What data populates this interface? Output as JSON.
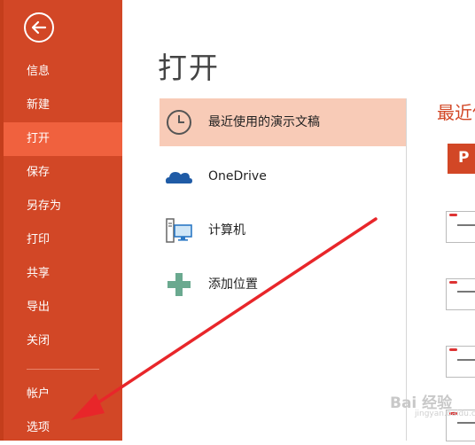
{
  "sidebar": {
    "items": [
      {
        "label": "信息",
        "active": false
      },
      {
        "label": "新建",
        "active": false
      },
      {
        "label": "打开",
        "active": true
      },
      {
        "label": "保存",
        "active": false
      },
      {
        "label": "另存为",
        "active": false
      },
      {
        "label": "打印",
        "active": false
      },
      {
        "label": "共享",
        "active": false
      },
      {
        "label": "导出",
        "active": false
      },
      {
        "label": "关闭",
        "active": false
      }
    ],
    "bottom_items": [
      {
        "label": "帐户"
      },
      {
        "label": "选项"
      }
    ]
  },
  "page": {
    "title": "打开"
  },
  "places": [
    {
      "label": "最近使用的演示文稿",
      "icon": "clock-icon",
      "selected": true
    },
    {
      "label": "OneDrive",
      "icon": "cloud-icon",
      "selected": false
    },
    {
      "label": "计算机",
      "icon": "computer-icon",
      "selected": false
    },
    {
      "label": "添加位置",
      "icon": "plus-icon",
      "selected": false
    }
  ],
  "recent": {
    "title": "最近使"
  },
  "watermark": {
    "brand": "Bai 经验",
    "sub": "jingyan.baidu.com"
  },
  "colors": {
    "sidebar": "#d24726",
    "active_item": "#f0613e",
    "selected_place": "#f8cbb7",
    "annotation_arrow": "#e8262a"
  }
}
